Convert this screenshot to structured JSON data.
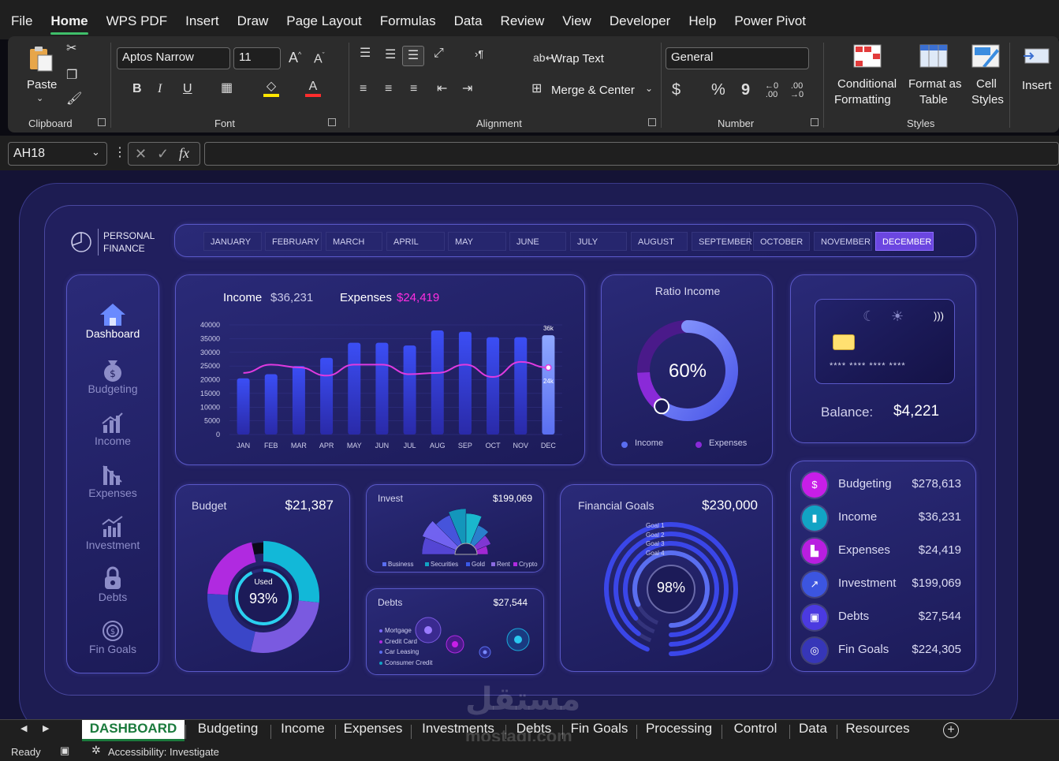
{
  "menu": [
    "File",
    "Home",
    "WPS PDF",
    "Insert",
    "Draw",
    "Page Layout",
    "Formulas",
    "Data",
    "Review",
    "View",
    "Developer",
    "Help",
    "Power Pivot"
  ],
  "ribbon": {
    "clipboard": {
      "paste": "Paste",
      "label": "Clipboard"
    },
    "font": {
      "name": "Aptos Narrow",
      "size": "11",
      "label": "Font",
      "bold": "B",
      "italic": "I",
      "underline": "U",
      "grow": "A^",
      "shrink": "Aˇ",
      "fill_color": "#ffe600",
      "font_color": "#ff2d2d"
    },
    "alignment": {
      "wrap": "Wrap Text",
      "merge": "Merge & Center",
      "label": "Alignment"
    },
    "number": {
      "format": "General",
      "label": "Number",
      "currency": "$",
      "percent": "%",
      "comma": "9"
    },
    "styles": {
      "conditional_1": "Conditional",
      "conditional_2": "Formatting",
      "format_table_1": "Format as",
      "format_table_2": "Table",
      "cell_styles_1": "Cell",
      "cell_styles_2": "Styles",
      "label": "Styles"
    },
    "cells": {
      "insert": "Insert"
    }
  },
  "formula_bar": {
    "name_box": "AH18",
    "fx": "fx",
    "value": ""
  },
  "dashboard": {
    "title_1": "PERSONAL",
    "title_2": "FINANCE",
    "months": [
      "JANUARY",
      "FEBRUARY",
      "MARCH",
      "APRIL",
      "MAY",
      "JUNE",
      "JULY",
      "AUGUST",
      "SEPTEMBER",
      "OCTOBER",
      "NOVEMBER",
      "DECEMBER"
    ],
    "selected_month": "DECEMBER",
    "nav": [
      {
        "label": "Dashboard",
        "icon": "home-icon",
        "active": true
      },
      {
        "label": "Budgeting",
        "icon": "money-bag-icon"
      },
      {
        "label": "Income",
        "icon": "bar-chart-icon"
      },
      {
        "label": "Expenses",
        "icon": "expenses-chart-icon"
      },
      {
        "label": "Investment",
        "icon": "investment-chart-icon"
      },
      {
        "label": "Debts",
        "icon": "lock-icon"
      },
      {
        "label": "Fin Goals",
        "icon": "target-icon"
      }
    ],
    "income_chart": {
      "income_label": "Income",
      "income_value": "$36,231",
      "expenses_label": "Expenses",
      "expenses_value": "$24,419",
      "max_label": "36k",
      "last_expense_label": "24k"
    },
    "ratio": {
      "title": "Ratio Income",
      "value": "60%",
      "percent": 60,
      "legend_income": "Income",
      "legend_expenses": "Expenses"
    },
    "card": {
      "masked": "**** **** **** ****",
      "balance_label": "Balance:",
      "balance_value": "$4,221"
    },
    "budget": {
      "title": "Budget",
      "value": "$21,387",
      "used_label": "Used",
      "used_value": "93%",
      "used_percent": 93
    },
    "invest": {
      "title": "Invest",
      "value": "$199,069",
      "legend": [
        "Business",
        "Securities",
        "Gold",
        "Rent",
        "Crypto"
      ]
    },
    "debts": {
      "title": "Debts",
      "value": "$27,544",
      "legend": [
        "Mortgage",
        "Credit Card",
        "Car Leasing",
        "Consumer Credit"
      ]
    },
    "goals": {
      "title": "Financial Goals",
      "value": "$230,000",
      "percent_label": "98%",
      "goals": [
        "Goal 1",
        "Goal 2",
        "Goal 3",
        "Goal 4"
      ]
    },
    "summary": [
      {
        "name": "Budgeting",
        "value": "$278,613",
        "icon": "money-bag-icon",
        "color": "#c81ee8"
      },
      {
        "name": "Income",
        "value": "$36,231",
        "icon": "bar-chart-icon",
        "color": "#12a3c4"
      },
      {
        "name": "Expenses",
        "value": "$24,419",
        "icon": "expenses-chart-icon",
        "color": "#b81ee0"
      },
      {
        "name": "Investment",
        "value": "$199,069",
        "icon": "investment-chart-icon",
        "color": "#3c55e0"
      },
      {
        "name": "Debts",
        "value": "$27,544",
        "icon": "lock-icon",
        "color": "#4b3ae0"
      },
      {
        "name": "Fin Goals",
        "value": "$224,305",
        "icon": "target-icon",
        "color": "#3636b8"
      }
    ]
  },
  "chart_data": {
    "type": "bar",
    "title": "",
    "categories": [
      "JAN",
      "FEB",
      "MAR",
      "APR",
      "MAY",
      "JUN",
      "JUL",
      "AUG",
      "SEP",
      "OCT",
      "NOV",
      "DEC"
    ],
    "ylim": [
      0,
      40000
    ],
    "yticks": [
      "40000",
      "35000",
      "30000",
      "25000",
      "20000",
      "15000",
      "10000",
      "5000",
      "0"
    ],
    "series": [
      {
        "name": "Income",
        "type": "bar",
        "values": [
          20500,
          22000,
          25000,
          28000,
          33500,
          33500,
          32500,
          38000,
          37500,
          35500,
          35500,
          36231
        ]
      },
      {
        "name": "Expenses",
        "type": "line",
        "values": [
          22500,
          25500,
          24500,
          21500,
          25500,
          25500,
          22000,
          22500,
          25500,
          21000,
          26500,
          24419
        ]
      }
    ]
  },
  "sheet_tabs": [
    "DASHBOARD",
    "Budgeting",
    "Income",
    "Expenses",
    "Investments",
    "Debts",
    "Fin Goals",
    "Processing",
    "Control",
    "Data",
    "Resources"
  ],
  "status": {
    "ready": "Ready",
    "accessibility": "Accessibility: Investigate"
  },
  "watermark": {
    "arabic": "مستقل",
    "latin": "mostaql.com"
  }
}
